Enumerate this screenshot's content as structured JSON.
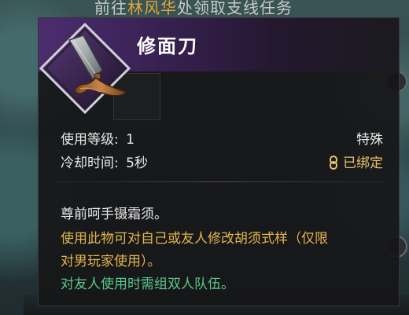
{
  "scene": {
    "top_text_prefix": "前往",
    "top_text_place": "林风华",
    "top_text_suffix": "处领取支线任务"
  },
  "tooltip": {
    "item_name": "修面刀",
    "stats": {
      "level_label": "使用等级:",
      "level_value": "1",
      "cooldown_label": "冷却时间:",
      "cooldown_value": "5秒",
      "quality": "特殊",
      "bound_status": "已绑定"
    },
    "description": {
      "flavor": "尊前呵手镊霜须。",
      "effect_line_1": "使用此物可对自己或友人修改胡须式样（仅限",
      "effect_line_2": "对男玩家使用）。",
      "note": "对友人使用时需组双人队伍。"
    }
  },
  "colors": {
    "header_purple": "#4c2d6e",
    "effect_text": "#e4b64a",
    "note_text": "#58c98a",
    "bound_text": "#e7c16b"
  },
  "icons": {
    "item_icon": "razor-icon",
    "bound_icon": "chain-link-icon"
  }
}
